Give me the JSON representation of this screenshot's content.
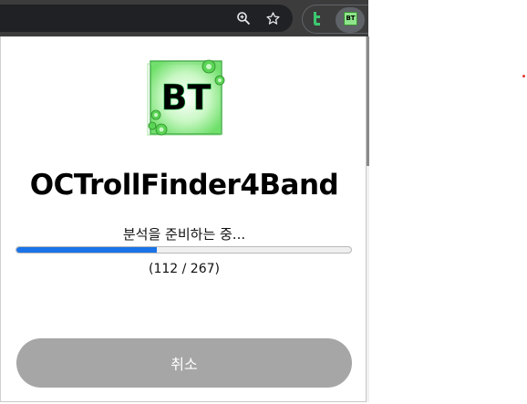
{
  "browser": {
    "icons": [
      "zoom-icon",
      "star-icon",
      "tweetdeck-extension-icon",
      "bt-extension-icon"
    ],
    "bt_extension_label": "BT"
  },
  "popup": {
    "logo_text": "BT",
    "title": "OCTrollFinder4Band",
    "status": "분석을 준비하는 중...",
    "progress": {
      "current": 112,
      "total": 267,
      "fraction": 0.4195,
      "label": "(112 / 267)"
    },
    "cancel_label": "취소"
  },
  "colors": {
    "toolbar": "#3c3c3c",
    "progress_fill": "#1a73e8",
    "button_bg": "#a6a6a6",
    "logo_green": "#7ee77a"
  }
}
